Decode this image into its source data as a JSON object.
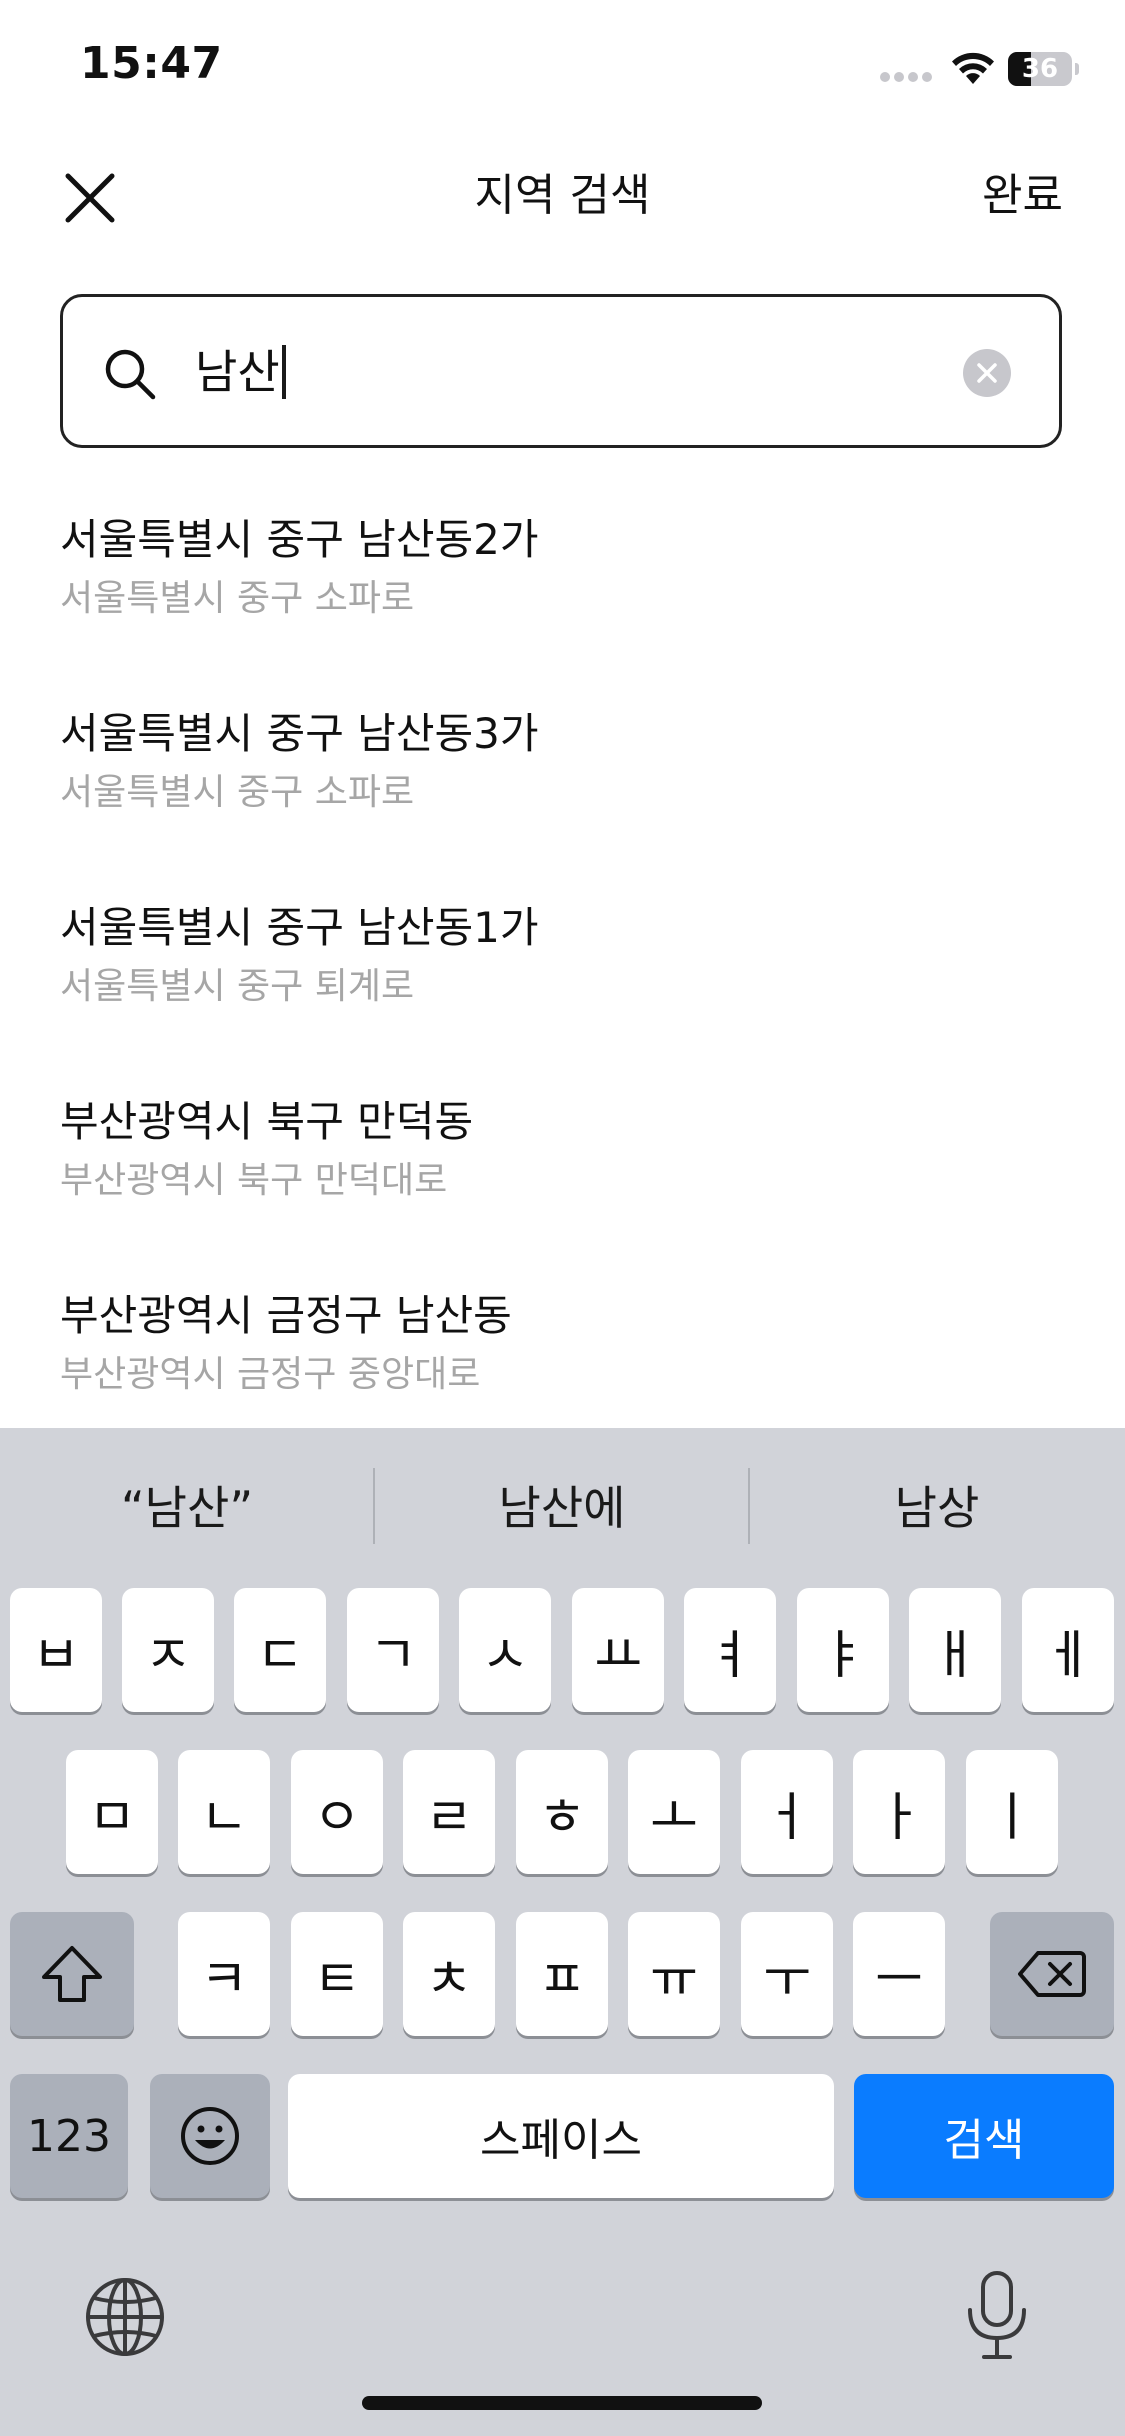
{
  "status_bar": {
    "time": "15:47",
    "battery_level": 36,
    "battery_text": "36"
  },
  "header": {
    "title": "지역 검색",
    "done_label": "완료",
    "close_icon": "close-icon"
  },
  "search": {
    "value": "남산",
    "icon": "search-icon",
    "clear_icon": "clear-icon"
  },
  "results": [
    {
      "title": "서울특별시 중구 남산동2가",
      "subtitle": "서울특별시 중구 소파로"
    },
    {
      "title": "서울특별시 중구 남산동3가",
      "subtitle": "서울특별시 중구 소파로"
    },
    {
      "title": "서울특별시 중구 남산동1가",
      "subtitle": "서울특별시 중구 퇴계로"
    },
    {
      "title": "부산광역시 북구 만덕동",
      "subtitle": "부산광역시 북구 만덕대로"
    },
    {
      "title": "부산광역시 금정구 남산동",
      "subtitle": "부산광역시 금정구 중앙대로"
    }
  ],
  "keyboard": {
    "suggestions": [
      "“남산”",
      "남산에",
      "남상"
    ],
    "row1": [
      "ㅂ",
      "ㅈ",
      "ㄷ",
      "ㄱ",
      "ㅅ",
      "ㅛ",
      "ㅕ",
      "ㅑ",
      "ㅐ",
      "ㅔ"
    ],
    "row2": [
      "ㅁ",
      "ㄴ",
      "ㅇ",
      "ㄹ",
      "ㅎ",
      "ㅗ",
      "ㅓ",
      "ㅏ",
      "ㅣ"
    ],
    "row3": [
      "ㅋ",
      "ㅌ",
      "ㅊ",
      "ㅍ",
      "ㅠ",
      "ㅜ",
      "ㅡ"
    ],
    "numbers_label": "123",
    "space_label": "스페이스",
    "search_label": "검색",
    "shift_icon": "shift-icon",
    "backspace_icon": "backspace-icon",
    "emoji_icon": "emoji-icon",
    "globe_icon": "globe-icon",
    "mic_icon": "microphone-icon",
    "accent_color": "#0a7cff"
  }
}
